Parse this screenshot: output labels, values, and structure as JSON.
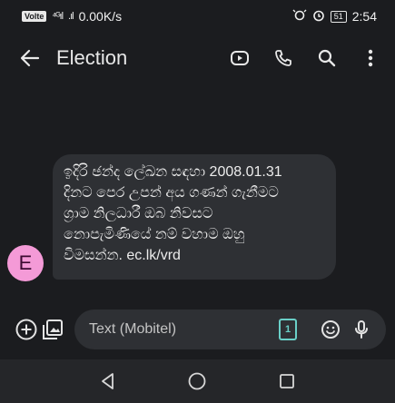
{
  "status_bar": {
    "sim_label": "Volte",
    "signal_1": "⁴ᴳıl",
    "signal_2": ".ıl",
    "net_speed": "0.00K/s",
    "battery": "51",
    "time": "2:54"
  },
  "app_bar": {
    "title": "Election",
    "icons": [
      "back-arrow-icon",
      "video-call-icon",
      "phone-icon",
      "search-icon",
      "more-vert-icon"
    ]
  },
  "conversation": {
    "messages": [
      {
        "sender_initial": "E",
        "text": "ඉදිරි ඡන්ද ලේඛන සඳහා 2008.01.31\nදිනට පෙර උපන් අය ගණන් ගැනීමට\nග්‍රාම නිලධාරී ඔබ නිවසට\nනොපැමිණියේ නම් වහාම ඔහු\nවිමසන්න. ec.lk/vrd"
      }
    ]
  },
  "composer": {
    "placeholder": "Text (Mobitel)",
    "sim_index": "1",
    "icons": [
      "add-circle-icon",
      "gallery-icon",
      "sim-icon",
      "emoji-icon",
      "mic-icon"
    ]
  },
  "colors": {
    "background": "#1b1c1f",
    "bubble": "#2e3034",
    "avatar": "#f49ad7",
    "sim_accent": "#6ad0c8"
  }
}
